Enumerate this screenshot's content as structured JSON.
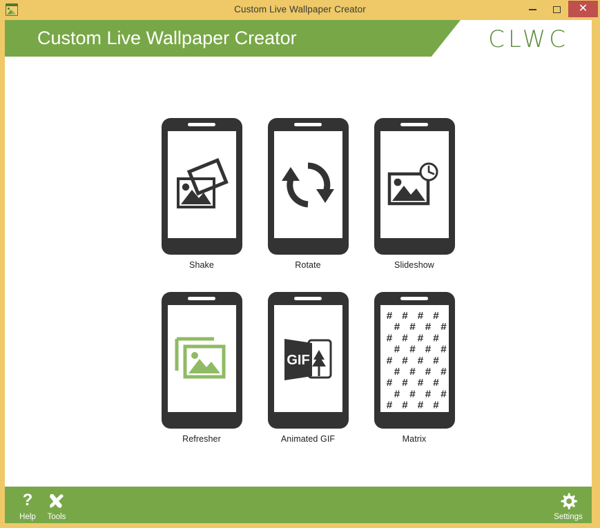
{
  "window": {
    "title": "Custom Live Wallpaper Creator",
    "app_icon": "picture-icon",
    "controls": {
      "minimize": "–",
      "maximize": "□",
      "close": "✕"
    },
    "colors": {
      "titlebar": "#efc968",
      "close_button": "#c0504d",
      "brand_green": "#78a748",
      "accent_green": "#8fbb63",
      "device_dark": "#333333",
      "logo_green": "#5d8b3c"
    }
  },
  "header": {
    "title": "Custom Live Wallpaper Creator",
    "brand": "CLWC"
  },
  "main": {
    "tiles": [
      {
        "label": "Shake",
        "icon": "shake-photo-icon",
        "color": "#333333"
      },
      {
        "label": "Rotate",
        "icon": "rotate-arrows-icon",
        "color": "#333333"
      },
      {
        "label": "Slideshow",
        "icon": "photo-clock-icon",
        "color": "#333333"
      },
      {
        "label": "Refresher",
        "icon": "stacked-photos-icon",
        "color": "#8fbb63"
      },
      {
        "label": "Animated GIF",
        "icon": "gif-panel-icon",
        "color": "#333333"
      },
      {
        "label": "Matrix",
        "icon": "hash-matrix-icon",
        "color": "#333333"
      }
    ],
    "gif_text": "GIF",
    "matrix_glyph": "#"
  },
  "footer": {
    "items": [
      {
        "label": "Help",
        "icon": "question-mark-icon"
      },
      {
        "label": "Tools",
        "icon": "wrench-screwdriver-icon"
      },
      {
        "label": "Settings",
        "icon": "gear-icon"
      }
    ]
  }
}
